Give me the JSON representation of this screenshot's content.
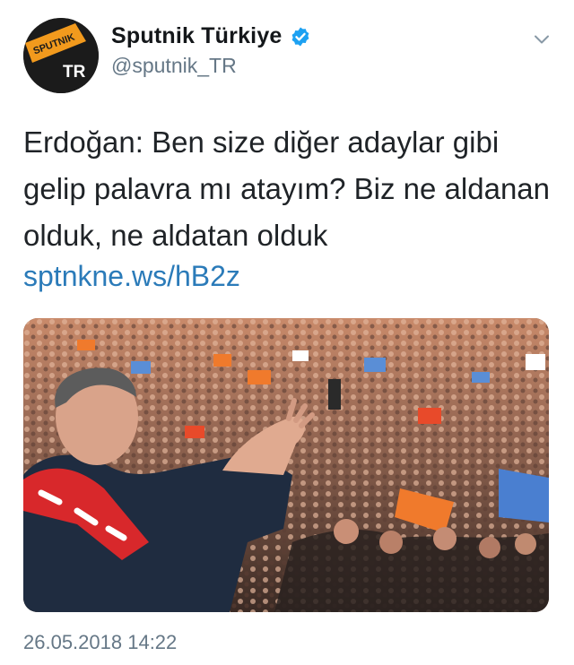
{
  "account": {
    "display_name": "Sputnik Türkiye",
    "handle": "@sputnik_TR",
    "avatar_text_top": "SPUTNIK",
    "avatar_text_bottom": "TR",
    "verified_icon": "verified-badge-icon",
    "accent_color": "#1da1f2"
  },
  "tweet": {
    "text_lines": [
      "Erdoğan: Ben size diğer adaylar gibi",
      "gelip palavra mı atayım? Biz ne aldanan",
      "olduk, ne aldatan olduk"
    ],
    "link": "sptnkne.ws/hB2z",
    "link_color": "#2b7bb9",
    "timestamp": "26.05.2018 14:22"
  },
  "menu": {
    "icon": "chevron-down-icon"
  }
}
